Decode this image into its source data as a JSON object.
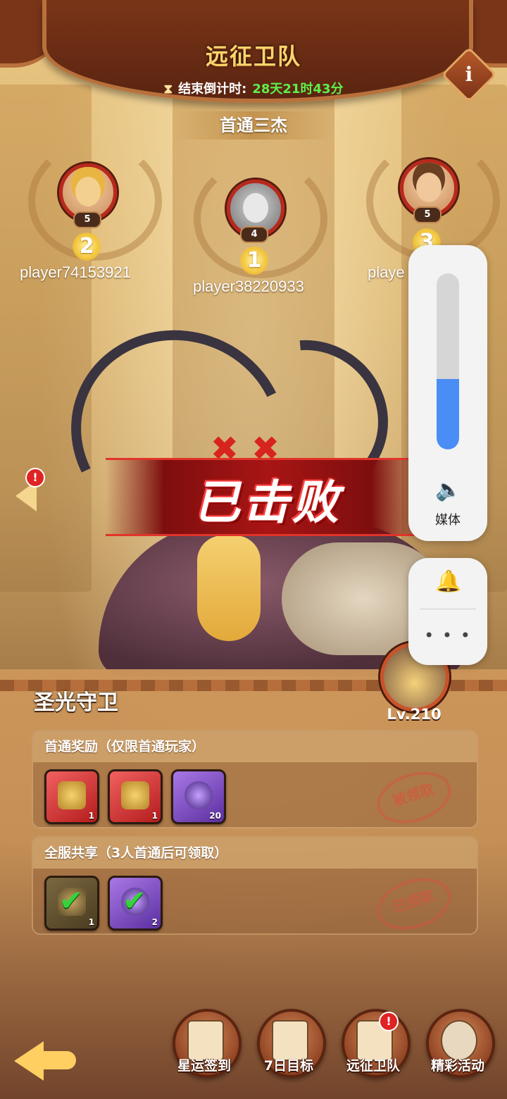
{
  "header": {
    "title": "远征卫队",
    "countdown_label": "结束倒计时:",
    "countdown_value": "28天21时43分",
    "info_icon": "i"
  },
  "top_three": {
    "title": "首通三杰",
    "players": [
      {
        "rank": "2",
        "name": "player74153921",
        "level": "5",
        "avatar": "blonde-kid-avatar"
      },
      {
        "rank": "1",
        "name": "player38220933",
        "level": "4",
        "avatar": "raccoon-avatar"
      },
      {
        "rank": "3",
        "name": "playe",
        "level": "5",
        "avatar": "brown-hair-avatar"
      }
    ]
  },
  "boss": {
    "status": "已击败",
    "status_marks": "✖✖",
    "name": "圣光守卫",
    "level": "Lv.210"
  },
  "rewards": {
    "first_clear": {
      "title": "首通奖励（仅限首通玩家）",
      "stamp": "被领取",
      "items": [
        {
          "type": "red-helmet-chest",
          "count": "1"
        },
        {
          "type": "red-helmet-chest",
          "count": "1"
        },
        {
          "type": "purple-stone",
          "count": "20"
        }
      ]
    },
    "server_share": {
      "title": "全服共享（3人首通后可领取）",
      "stamp": "已领取",
      "items": [
        {
          "type": "olive-chest",
          "count": "1",
          "check": "✔"
        },
        {
          "type": "purple-chest",
          "count": "2",
          "check": "✔"
        }
      ]
    }
  },
  "nav": {
    "items": [
      {
        "label": "星运签到"
      },
      {
        "label": "7日目标"
      },
      {
        "label": "远征卫队"
      },
      {
        "label": "精彩活动"
      }
    ],
    "alert": "!"
  },
  "volume_overlay": {
    "level_fraction": 0.4,
    "label": "媒体",
    "speaker_icon": "🔈",
    "bell_icon": "🔔",
    "more": "• • •"
  },
  "colors": {
    "countdown": "#5df04a",
    "title": "#ffd46b",
    "accent_red": "#a81515",
    "volume": "#4a8df5"
  }
}
